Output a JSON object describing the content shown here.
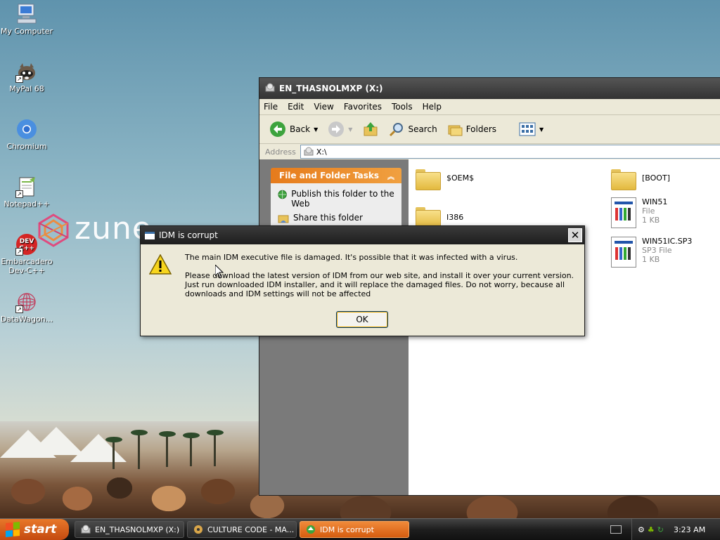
{
  "desktop": {
    "icons": [
      {
        "label": "My Computer",
        "icon": "computer-icon"
      },
      {
        "label": "MyPal 68",
        "icon": "raccoon-icon"
      },
      {
        "label": "Chromium",
        "icon": "chromium-icon"
      },
      {
        "label": "Notepad++",
        "icon": "notepadpp-icon"
      },
      {
        "label": "Embarcadero Dev-C++",
        "icon": "devcpp-icon"
      },
      {
        "label": "DataWagon...",
        "icon": "datawagon-icon"
      }
    ],
    "wallpaper_text": "zune"
  },
  "explorer": {
    "title": "EN_THASNOLMXP (X:)",
    "menu": [
      "File",
      "Edit",
      "View",
      "Favorites",
      "Tools",
      "Help"
    ],
    "toolbar": {
      "back": "Back",
      "search": "Search",
      "folders": "Folders"
    },
    "address": {
      "label": "Address",
      "value": "X:\\"
    },
    "tasks": {
      "header": "File and Folder Tasks",
      "items": [
        "Publish this folder to the Web",
        "Share this folder"
      ]
    },
    "files": [
      {
        "name": "$OEM$",
        "type": "folder"
      },
      {
        "name": "[BOOT]",
        "type": "folder"
      },
      {
        "name": "I386",
        "type": "folder"
      },
      {
        "name": "WIN51",
        "kind": "File",
        "size": "1 KB",
        "type": "file"
      },
      {
        "name": "WIN51IC.SP3",
        "kind": "SP3 File",
        "size": "1 KB",
        "type": "file"
      }
    ]
  },
  "dialog": {
    "title": "IDM is corrupt",
    "line1": "The main IDM executive file is damaged. It's possible that it was infected with a virus.",
    "line2": "Please download the latest version of IDM from our web site, and install it over your current version. Just run downloaded IDM installer, and it will replace the damaged files. Do not worry, because all downloads and IDM settings will not be affected",
    "ok": "OK",
    "close": "✕"
  },
  "taskbar": {
    "start": "start",
    "buttons": [
      {
        "label": "EN_THASNOLMXP (X:)",
        "active": false
      },
      {
        "label": "CULTURE CODE - MA...",
        "active": false
      },
      {
        "label": "IDM is corrupt",
        "active": true
      }
    ],
    "clock": "3:23 AM"
  },
  "colors": {
    "accent_orange": "#e67b1c",
    "taskbar_dark": "#1e1e1e",
    "dialog_face": "#ece9d8"
  }
}
